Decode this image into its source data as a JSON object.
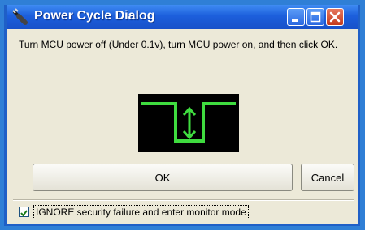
{
  "window": {
    "title": "Power Cycle Dialog",
    "icon": "plug-icon",
    "controls": [
      "minimize-icon",
      "maximize-icon",
      "close-icon"
    ]
  },
  "message": "Turn MCU power off (Under 0.1v), turn MCU power on, and then click OK.",
  "illustration": {
    "icon": "power-cycle-waveform-icon",
    "color": "#3fdc3f",
    "background": "#000000"
  },
  "buttons": {
    "ok": "OK",
    "cancel": "Cancel"
  },
  "checkbox": {
    "label": "IGNORE security failure and enter monitor mode",
    "checked": true
  },
  "colors": {
    "titlebar": "#1c5fdc",
    "dialog_bg": "#ece9d8",
    "close_button": "#c43a1c"
  }
}
